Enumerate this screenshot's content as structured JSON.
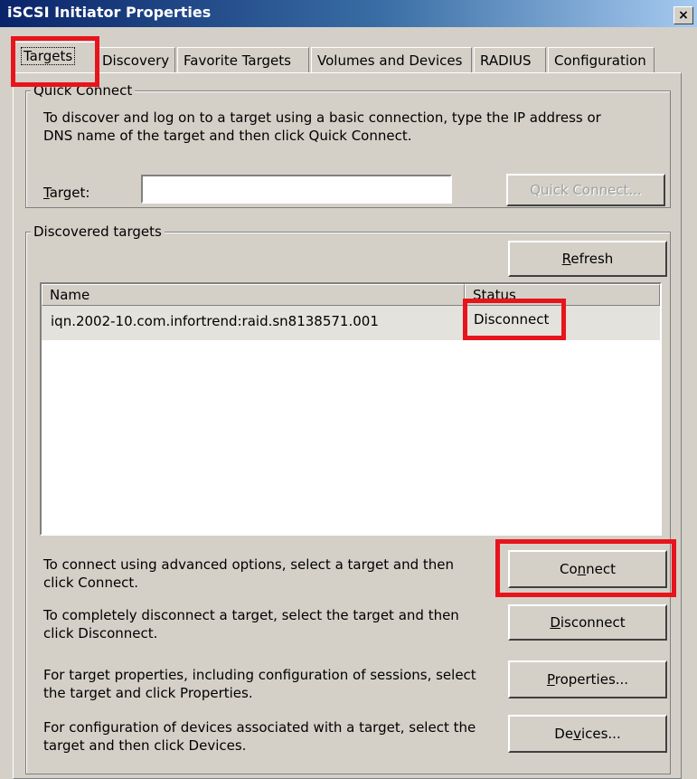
{
  "window": {
    "title": "iSCSI Initiator Properties",
    "close_glyph": "×"
  },
  "tabs": [
    "Targets",
    "Discovery",
    "Favorite Targets",
    "Volumes and Devices",
    "RADIUS",
    "Configuration"
  ],
  "quick_connect": {
    "legend": "Quick Connect",
    "description": "To discover and log on to a target using a basic connection, type the IP address or DNS name of the target and then click Quick Connect.",
    "target_label": "Target:",
    "target_value": "",
    "button": "Quick Connect..."
  },
  "discovered": {
    "legend": "Discovered targets",
    "refresh_button": "Refresh",
    "columns": [
      "Name",
      "Status"
    ],
    "rows": [
      {
        "name": "iqn.2002-10.com.infortrend:raid.sn8138571.001",
        "status": "Disconnect"
      }
    ]
  },
  "actions": [
    {
      "text": "To connect using advanced options, select a target and then click Connect.",
      "button": "Connect"
    },
    {
      "text": "To completely disconnect a target, select the target and then click Disconnect.",
      "button": "Disconnect"
    },
    {
      "text": "For target properties, including configuration of sessions, select the target and click Properties.",
      "button": "Properties..."
    },
    {
      "text": "For configuration of devices associated with a target, select the target and then click Devices.",
      "button": "Devices..."
    }
  ],
  "colors": {
    "highlight": "#e8141c",
    "titlebar": "#0a246a",
    "face": "#d4d0c8"
  }
}
